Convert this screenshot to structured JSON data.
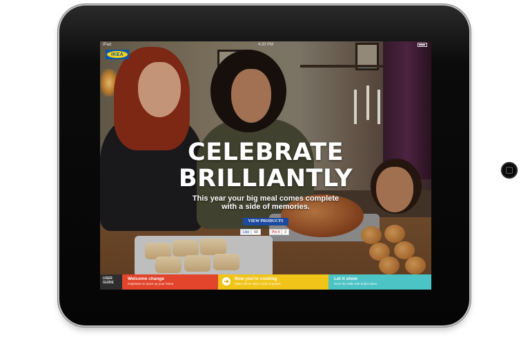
{
  "status_bar": {
    "carrier": "iPad",
    "time": "4:20 PM"
  },
  "brand": {
    "logo_text": "IKEA"
  },
  "hero": {
    "headline_line1": "CELEBRATE",
    "headline_line2": "BRILLIANTLY",
    "subtitle_line1": "This year your big meal comes complete",
    "subtitle_line2": "with a side of memories."
  },
  "cta": {
    "view_products": "VIEW PRODUCTS"
  },
  "social": {
    "like_label": "Like",
    "like_count": "69",
    "pin_label": "Pin it",
    "pin_count": "3"
  },
  "bottom_nav": {
    "user_guide_line1": "USER",
    "user_guide_line2": "GUIDE",
    "tabs": [
      {
        "title": "Welcome change",
        "desc": "Inspiration to spice up your home",
        "color": "#e2442c"
      },
      {
        "title": "Now you're cooking",
        "desc": "Make dinner with a side of genius",
        "color": "#f0c419",
        "icon": "arrow-right-icon"
      },
      {
        "title": "Let it show",
        "desc": "Deck the halls with bright ideas",
        "color": "#4cc3c4"
      }
    ]
  }
}
